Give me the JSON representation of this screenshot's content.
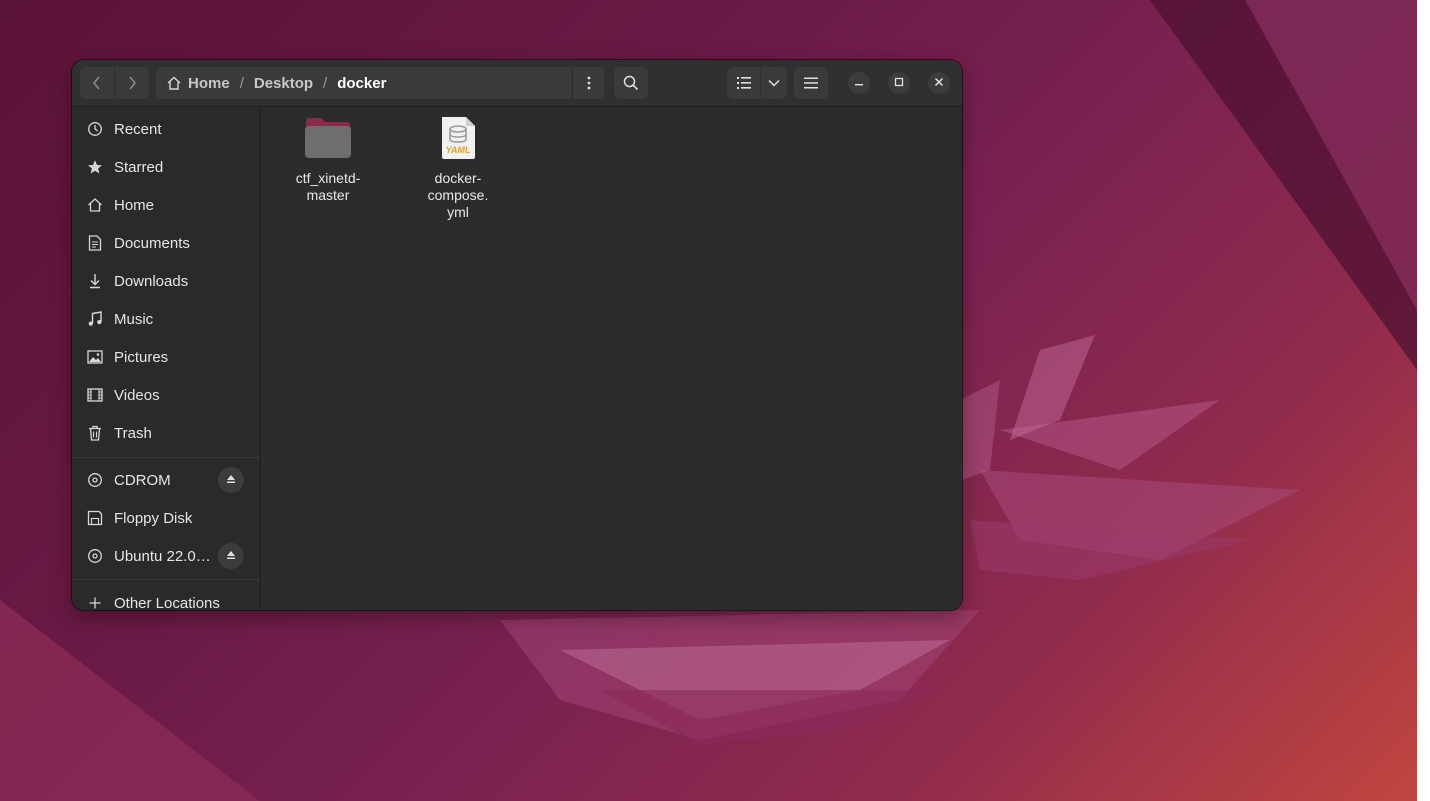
{
  "colors": {
    "window_bg": "#2c2c2c",
    "headerbar_bg": "#303030",
    "sidebar_bg": "#2a2a2a",
    "button_bg": "#3a3a3a",
    "text": "#e6e6e6",
    "highlight": "#e0161e",
    "folder_body": "#6e6e6e",
    "folder_tab": "#8a2a4a",
    "yaml_accent": "#e8a227"
  },
  "headerbar": {
    "back_icon": "chevron-left-icon",
    "forward_icon": "chevron-right-icon",
    "path": {
      "home_icon": "home-icon",
      "home": "Home",
      "desktop": "Desktop",
      "current": "docker",
      "separator": "/"
    },
    "menu_icon": "vertical-dots-icon",
    "search_icon": "search-icon",
    "view_icon": "list-view-icon",
    "view_dropdown_icon": "chevron-down-icon",
    "main_menu_icon": "hamburger-icon",
    "minimize_icon": "minimize-icon",
    "maximize_icon": "maximize-icon",
    "close_icon": "close-icon"
  },
  "sidebar": {
    "places": [
      {
        "label": "Recent",
        "icon": "clock-icon"
      },
      {
        "label": "Starred",
        "icon": "star-icon"
      },
      {
        "label": "Home",
        "icon": "home-icon"
      },
      {
        "label": "Documents",
        "icon": "document-icon"
      },
      {
        "label": "Downloads",
        "icon": "download-icon"
      },
      {
        "label": "Music",
        "icon": "music-icon"
      },
      {
        "label": "Pictures",
        "icon": "picture-icon"
      },
      {
        "label": "Videos",
        "icon": "video-icon"
      },
      {
        "label": "Trash",
        "icon": "trash-icon"
      }
    ],
    "devices": [
      {
        "label": "CDROM",
        "icon": "disc-icon",
        "eject": true
      },
      {
        "label": "Floppy Disk",
        "icon": "floppy-icon",
        "eject": false
      },
      {
        "label": "Ubuntu 22.0…",
        "icon": "disc-icon",
        "eject": true
      }
    ],
    "other": {
      "label": "Other Locations",
      "icon": "plus-icon"
    }
  },
  "files": [
    {
      "name": "ctf_xinetd-master",
      "line1": "ctf_xinetd-",
      "line2": "master",
      "line3": "",
      "type": "folder",
      "icon": "folder-icon"
    },
    {
      "name": "docker-compose.yml",
      "line1": "docker-",
      "line2": "compose.",
      "line3": "yml",
      "type": "yaml",
      "icon": "yaml-file-icon",
      "badge": "YAML",
      "highlighted": true
    }
  ]
}
